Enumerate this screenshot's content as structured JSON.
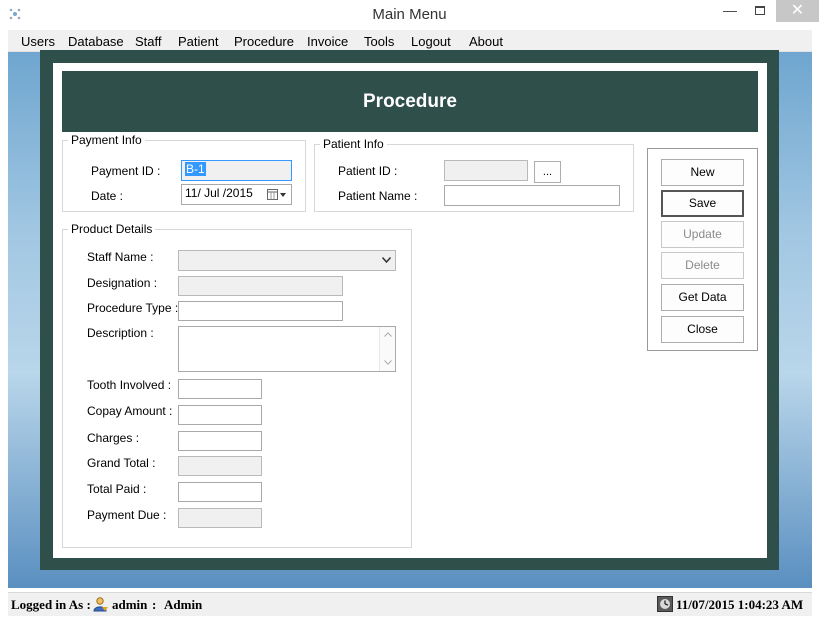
{
  "window": {
    "title": "Main Menu",
    "minimize_glyph": "—",
    "close_glyph": "✕"
  },
  "menu": [
    "Users",
    "Database",
    "Staff",
    "Patient",
    "Procedure",
    "Invoice",
    "Tools",
    "Logout",
    "About"
  ],
  "form": {
    "banner_title": "Procedure",
    "payment_info": {
      "legend": "Payment Info",
      "payment_id_label": "Payment ID :",
      "payment_id_value": "B-1",
      "date_label": "Date :",
      "date_value": "11/ Jul /2015"
    },
    "patient_info": {
      "legend": "Patient Info",
      "patient_id_label": "Patient ID :",
      "patient_id_value": "",
      "browse_label": "...",
      "patient_name_label": "Patient Name :",
      "patient_name_value": ""
    },
    "product_details": {
      "legend": "Product Details",
      "staff_name_label": "Staff Name :",
      "designation_label": "Designation :",
      "procedure_type_label": "Procedure Type :",
      "description_label": "Description :",
      "tooth_involved_label": "Tooth Involved :",
      "copay_amount_label": "Copay Amount :",
      "charges_label": "Charges :",
      "grand_total_label": "Grand Total :",
      "total_paid_label": "Total Paid :",
      "payment_due_label": "Payment Due :"
    },
    "buttons": {
      "new": "New",
      "save": "Save",
      "update": "Update",
      "delete": "Delete",
      "get_data": "Get Data",
      "close": "Close"
    }
  },
  "status": {
    "logged_in_label": "Logged in As :",
    "username": "admin",
    "separator": ":",
    "role": "Admin",
    "datetime": "11/07/2015 1:04:23 AM"
  },
  "colors": {
    "panel": "#2f4f4b",
    "selection": "#3399ff"
  },
  "icons": {
    "app": "app-icon",
    "calendar": "calendar-icon",
    "user": "user-icon",
    "clock": "clock-icon"
  }
}
